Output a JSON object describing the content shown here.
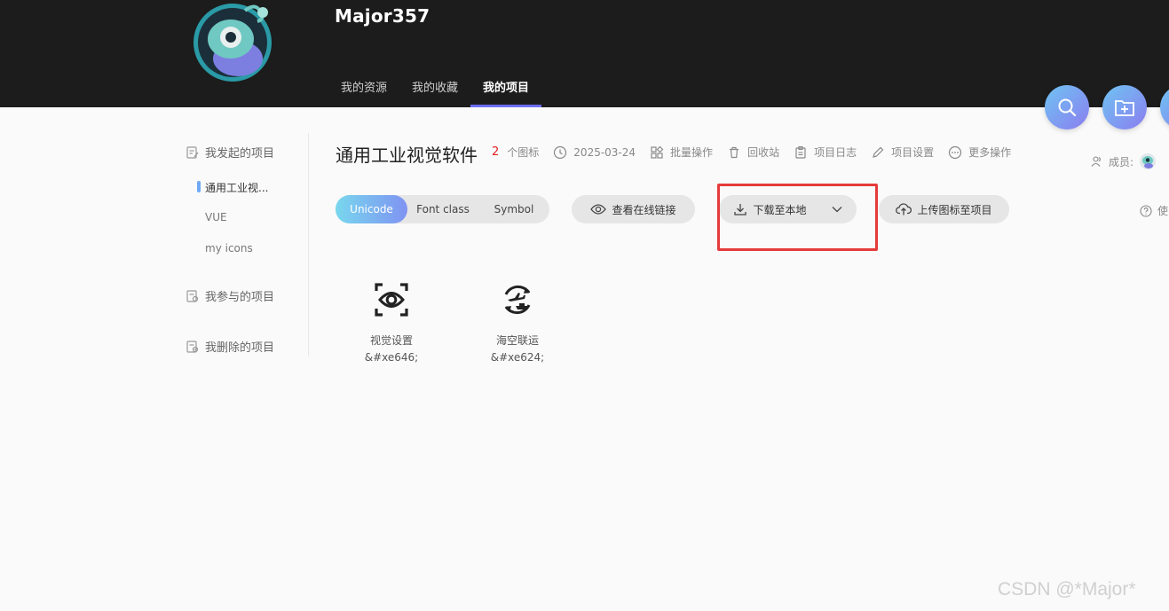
{
  "header": {
    "username": "Major357",
    "tabs": [
      {
        "label": "我的资源",
        "active": false
      },
      {
        "label": "我的收藏",
        "active": false
      },
      {
        "label": "我的项目",
        "active": true
      }
    ],
    "accent": "#6d6ef5",
    "float_buttons": [
      "search-icon",
      "add-folder-icon",
      "partial-button"
    ]
  },
  "sidebar": {
    "initiated_label": "我发起的项目",
    "projects": [
      "通用工业视...",
      "VUE",
      "my icons"
    ],
    "active_project_index": 0,
    "participated_label": "我参与的项目",
    "deleted_label": "我删除的项目"
  },
  "project": {
    "title": "通用工业视觉软件",
    "icon_count": "2",
    "icon_count_label": "个图标",
    "date": "2025-03-24",
    "actions": {
      "batch": "批量操作",
      "recycle": "回收站",
      "log": "项目日志",
      "settings": "项目设置",
      "more": "更多操作"
    },
    "members_label": "成员:",
    "help_label": "使"
  },
  "toolbar": {
    "formats": [
      "Unicode",
      "Font class",
      "Symbol"
    ],
    "active_format": "Unicode",
    "view_link": "查看在线链接",
    "download": "下载至本地",
    "upload": "上传图标至项目"
  },
  "icons": [
    {
      "name": "视觉设置",
      "code": "&#xe646;",
      "icon": "eye-scan-icon"
    },
    {
      "name": "海空联运",
      "code": "&#xe624;",
      "icon": "air-sea-transport-icon"
    }
  ],
  "watermark": "CSDN @*Major*",
  "colors": {
    "header_bg": "#1c1c1c",
    "highlight": "#e53b3b",
    "count": "#e02020"
  }
}
